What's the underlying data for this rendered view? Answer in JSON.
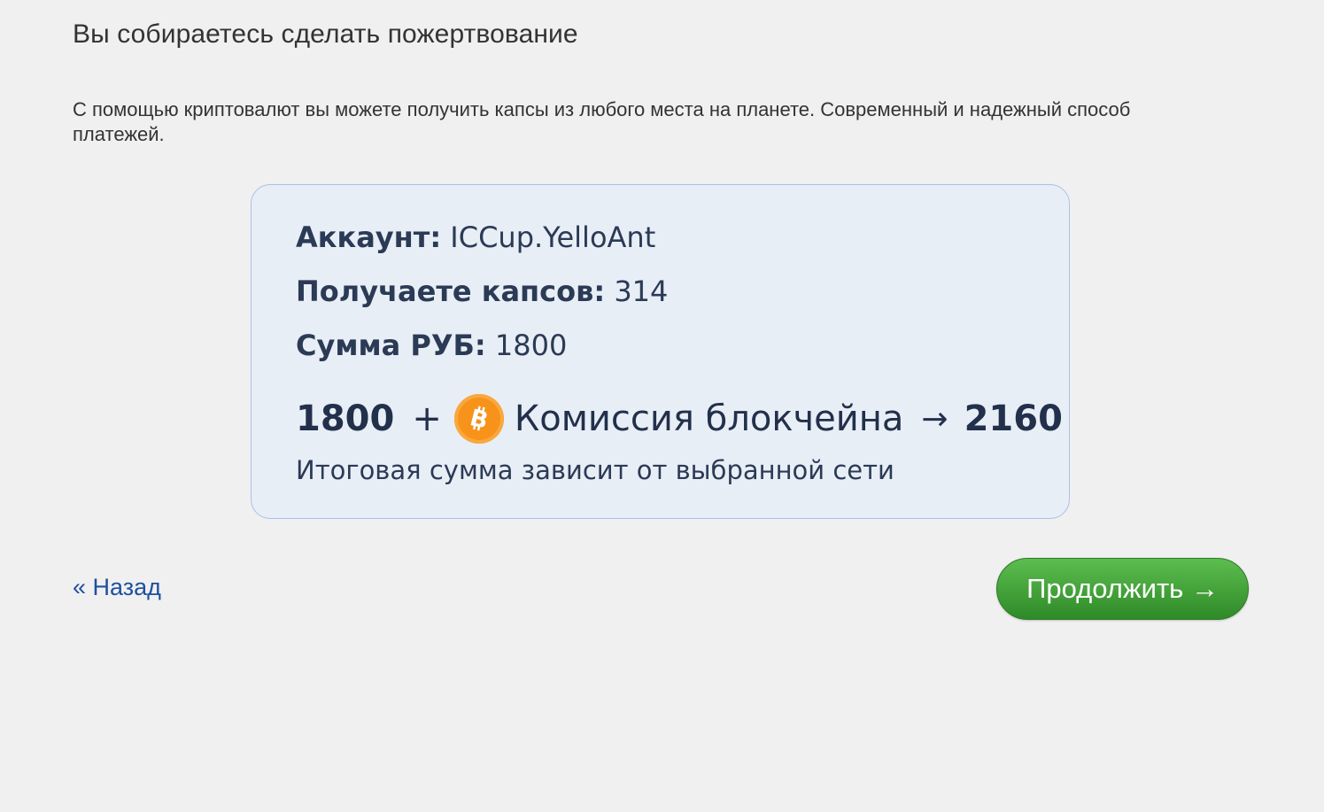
{
  "page": {
    "title": "Вы собираетесь сделать пожертвование",
    "description": "С помощью криптовалют вы можете получить капсы из любого места на планете. Современный и надежный способ платежей."
  },
  "summary": {
    "account_label": "Аккаунт:",
    "account_value": "ICCup.YelloAnt",
    "caps_label": "Получаете капсов:",
    "caps_value": "314",
    "sum_label": "Сумма РУБ:",
    "sum_value": "1800"
  },
  "calculation": {
    "base_amount": "1800",
    "plus": "+",
    "fee_label": "Комиссия блокчейна",
    "arrow": "→",
    "total": "2160",
    "note": "Итоговая сумма зависит от выбранной сети"
  },
  "icons": {
    "crypto": "bitcoin-icon",
    "crypto_color": "#f7931a"
  },
  "nav": {
    "back_label": "« Назад",
    "continue_label": "Продолжить →"
  },
  "colors": {
    "background": "#f0f0f0",
    "card_bg": "#e8eef6",
    "card_border": "#a9c1e6",
    "link": "#1f4fa0",
    "button_green": "#3a9a31"
  }
}
